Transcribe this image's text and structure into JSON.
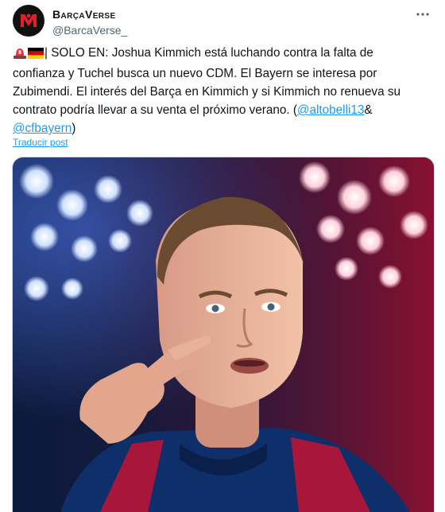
{
  "account": {
    "display_name": "BarçaVerse",
    "handle": "@BarcaVerse_"
  },
  "tweet": {
    "text_before": "| SOLO EN: Joshua Kimmich está luchando contra la falta de confianza y Tuchel busca un nuevo CDM. El Bayern se interesa por Zubimendi. El interés del Barça en Kimmich y si Kimmich no renueva su contrato podría llevar a su venta el próximo verano. (",
    "mention_1": "@altobelli13",
    "text_between": "& ",
    "mention_2": "@cfbayern",
    "text_after": ")",
    "translate_label": "Traducir post"
  },
  "media": {
    "alt": "Player photo"
  },
  "icons": {
    "more": "more-dots-icon",
    "siren": "siren-icon",
    "flag": "germany-flag-icon"
  },
  "colors": {
    "link": "#1d9bf0",
    "secondary": "#536471"
  }
}
